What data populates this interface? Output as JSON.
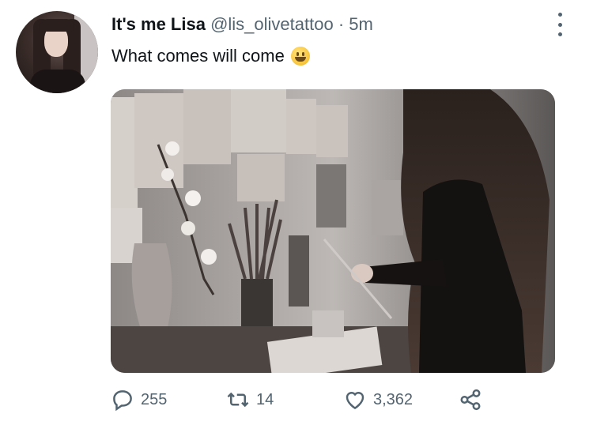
{
  "tweet": {
    "display_name": "It's me Lisa",
    "handle": "@lis_olivetattoo",
    "separator": "·",
    "timestamp": "5m",
    "text": "What comes will come",
    "emoji": "grinning-face-icon"
  },
  "actions": {
    "reply_count": "255",
    "retweet_count": "14",
    "like_count": "3,362"
  },
  "colors": {
    "text_primary": "#0f1419",
    "text_secondary": "#536471"
  }
}
